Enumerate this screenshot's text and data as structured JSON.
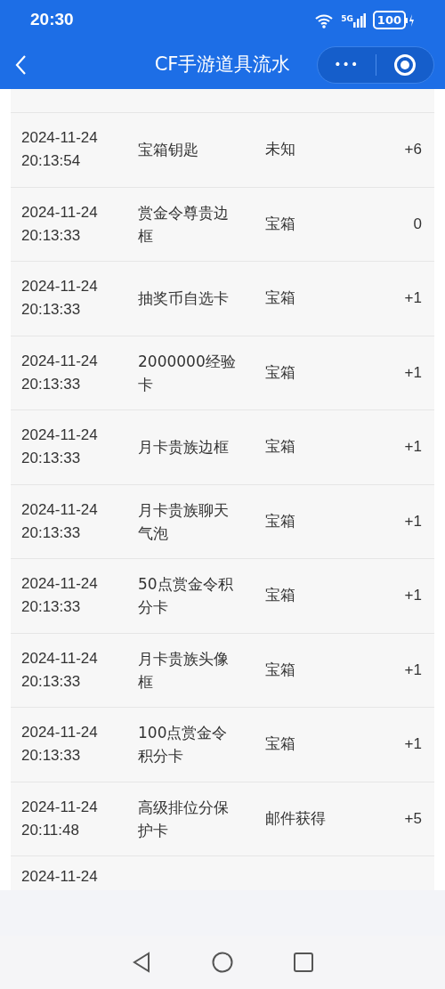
{
  "status_bar": {
    "time": "20:30",
    "network": "5G",
    "battery": "100"
  },
  "header": {
    "title": "CF手游道具流水",
    "more_button": "•••"
  },
  "rows": [
    {
      "date": "2024-11-24",
      "time": "20:13:54",
      "item": "宝箱钥匙",
      "source": "未知",
      "amount": "+6"
    },
    {
      "date": "2024-11-24",
      "time": "20:13:33",
      "item": "赏金令尊贵边框",
      "source": "宝箱",
      "amount": "0"
    },
    {
      "date": "2024-11-24",
      "time": "20:13:33",
      "item": "抽奖币自选卡",
      "source": "宝箱",
      "amount": "+1"
    },
    {
      "date": "2024-11-24",
      "time": "20:13:33",
      "item": "2000000经验卡",
      "source": "宝箱",
      "amount": "+1"
    },
    {
      "date": "2024-11-24",
      "time": "20:13:33",
      "item": "月卡贵族边框",
      "source": "宝箱",
      "amount": "+1"
    },
    {
      "date": "2024-11-24",
      "time": "20:13:33",
      "item": "月卡贵族聊天气泡",
      "source": "宝箱",
      "amount": "+1"
    },
    {
      "date": "2024-11-24",
      "time": "20:13:33",
      "item": "50点赏金令积分卡",
      "source": "宝箱",
      "amount": "+1"
    },
    {
      "date": "2024-11-24",
      "time": "20:13:33",
      "item": "月卡贵族头像框",
      "source": "宝箱",
      "amount": "+1"
    },
    {
      "date": "2024-11-24",
      "time": "20:13:33",
      "item": "100点赏金令积分卡",
      "source": "宝箱",
      "amount": "+1"
    },
    {
      "date": "2024-11-24",
      "time": "20:11:48",
      "item": "高级排位分保护卡",
      "source": "邮件获得",
      "amount": "+5"
    },
    {
      "date": "2024-11-24"
    }
  ]
}
